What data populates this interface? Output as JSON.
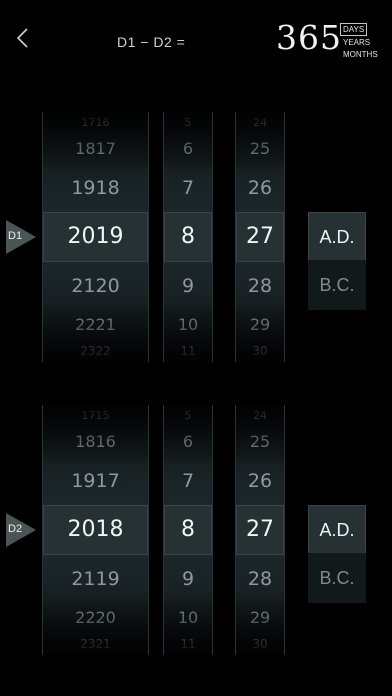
{
  "header": {
    "back_icon": "chevron-left-icon",
    "formula": "D1 − D2 =",
    "result": "365",
    "units": [
      "DAYS",
      "YEARS",
      "MONTHS"
    ],
    "active_unit": "DAYS"
  },
  "d1": {
    "label": "D1",
    "years": [
      "1716",
      "1817",
      "1918",
      "2019",
      "2120",
      "2221",
      "2322"
    ],
    "months": [
      "5",
      "6",
      "7",
      "8",
      "9",
      "10",
      "11"
    ],
    "days": [
      "24",
      "25",
      "26",
      "27",
      "28",
      "29",
      "30"
    ],
    "era_selected": "A.D.",
    "era_other": "B.C."
  },
  "d2": {
    "label": "D2",
    "years": [
      "1715",
      "1816",
      "1917",
      "2018",
      "2119",
      "2220",
      "2321"
    ],
    "months": [
      "5",
      "6",
      "7",
      "8",
      "9",
      "10",
      "11"
    ],
    "days": [
      "24",
      "25",
      "26",
      "27",
      "28",
      "29",
      "30"
    ],
    "era_selected": "A.D.",
    "era_other": "B.C."
  }
}
